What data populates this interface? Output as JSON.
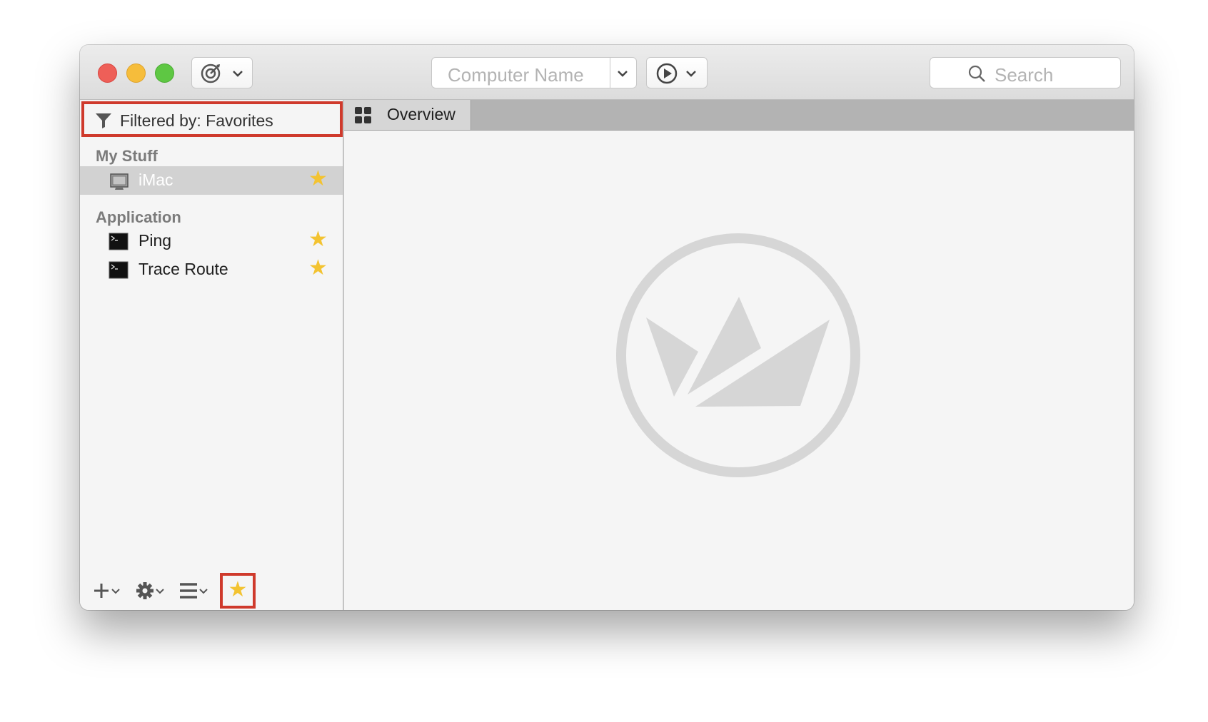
{
  "toolbar": {
    "computer_name_placeholder": "Computer Name",
    "search_placeholder": "Search"
  },
  "sidebar": {
    "filter_label": "Filtered by: Favorites",
    "sections": [
      {
        "title": "My Stuff",
        "items": [
          {
            "label": "iMac",
            "favorite": true,
            "icon": "imac-icon",
            "selected": true
          }
        ]
      },
      {
        "title": "Application",
        "items": [
          {
            "label": "Ping",
            "favorite": true,
            "icon": "terminal-icon"
          },
          {
            "label": "Trace Route",
            "favorite": true,
            "icon": "terminal-icon"
          }
        ]
      }
    ]
  },
  "tabs": [
    {
      "label": "Overview",
      "icon": "grid-icon",
      "active": true
    }
  ],
  "colors": {
    "favorite_star": "#f3c331",
    "highlight_box": "#cf3a2c",
    "selected_row": "#d2d2d2"
  }
}
